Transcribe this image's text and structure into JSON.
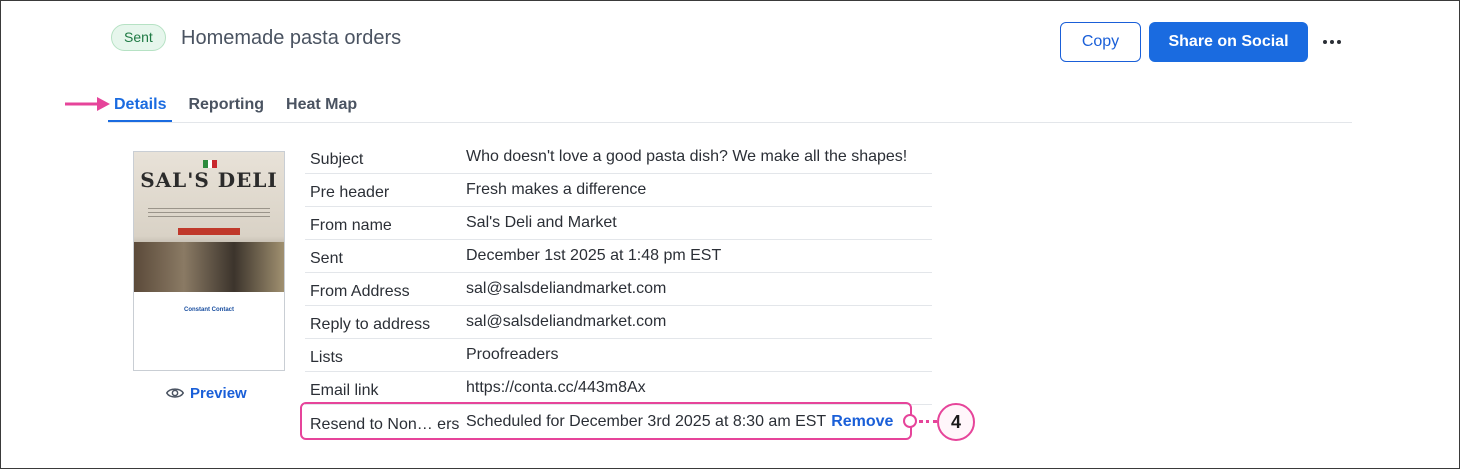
{
  "header": {
    "status_badge": "Sent",
    "title": "Homemade pasta orders",
    "copy_label": "Copy",
    "share_label": "Share on Social"
  },
  "tabs": [
    {
      "label": "Details",
      "active": true
    },
    {
      "label": "Reporting",
      "active": false
    },
    {
      "label": "Heat Map",
      "active": false
    }
  ],
  "thumbnail": {
    "logo_text": "SAL'S DELI",
    "brand_footer": "Constant Contact"
  },
  "preview_label": "Preview",
  "details": [
    {
      "label": "Subject",
      "value": "Who doesn't love a good pasta dish? We make all the shapes!"
    },
    {
      "label": "Pre header",
      "value": "Fresh makes a difference"
    },
    {
      "label": "From name",
      "value": "Sal's Deli and Market"
    },
    {
      "label": "Sent",
      "value": "December 1st 2025 at 1:48 pm EST"
    },
    {
      "label": "From Address",
      "value": "sal@salsdeliandmarket.com"
    },
    {
      "label": "Reply to address",
      "value": "sal@salsdeliandmarket.com"
    },
    {
      "label": "Lists",
      "value": "Proofreaders"
    },
    {
      "label": "Email link",
      "value": "https://conta.cc/443m8Ax"
    },
    {
      "label": "Resend to Non… ers",
      "value": "Scheduled for December 3rd 2025 at 8:30 am EST",
      "action": "Remove"
    }
  ],
  "annotation": {
    "step": "4"
  },
  "colors": {
    "accent": "#1a6be0",
    "highlight": "#e6449a",
    "sent_badge_bg": "#e6f6ec"
  }
}
